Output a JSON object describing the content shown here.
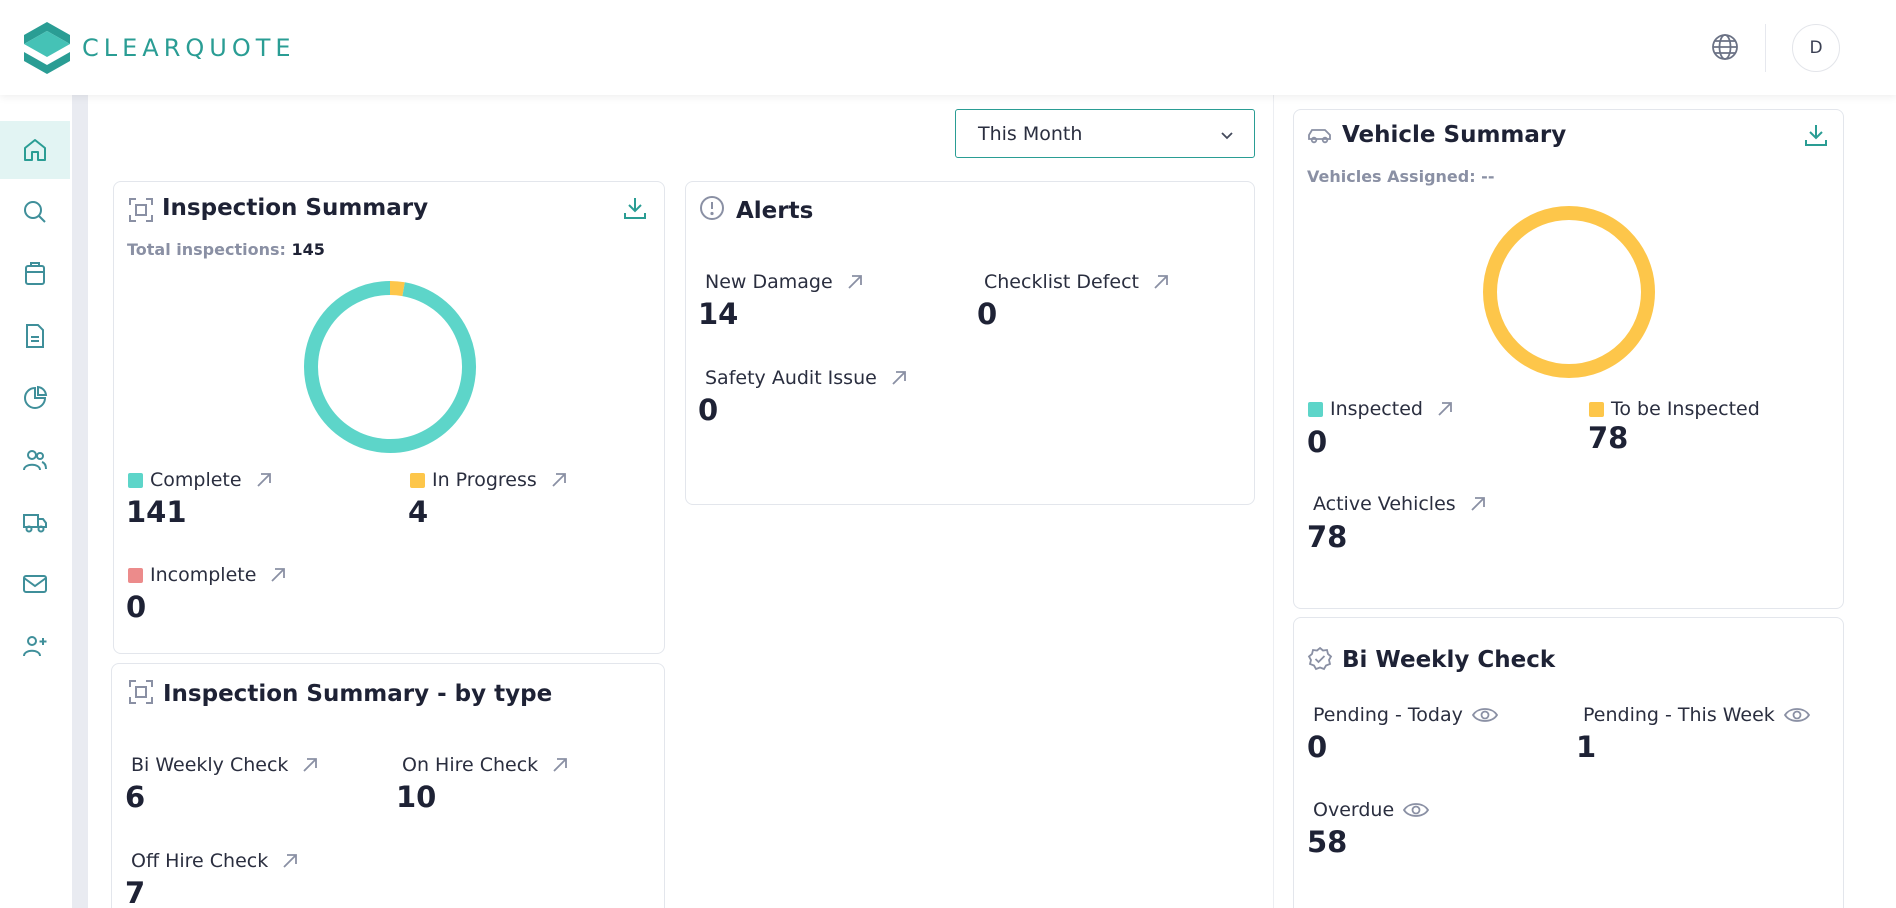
{
  "app": {
    "logo_text": "CLEARQUOTE",
    "user_initial": "D"
  },
  "colors": {
    "teal": "#5dd5c9",
    "yellow": "#fdc64a",
    "red": "#ec8b8b",
    "brand": "#2a9d94"
  },
  "filter": {
    "selected": "This Month"
  },
  "sidebar": {
    "items": [
      {
        "icon": "home-icon",
        "active": true
      },
      {
        "icon": "search-icon",
        "active": false
      },
      {
        "icon": "clipboard-icon",
        "active": false
      },
      {
        "icon": "document-icon",
        "active": false
      },
      {
        "icon": "pie-chart-icon",
        "active": false
      },
      {
        "icon": "users-icon",
        "active": false
      },
      {
        "icon": "truck-icon",
        "active": false
      },
      {
        "icon": "mail-icon",
        "active": false
      },
      {
        "icon": "user-plus-icon",
        "active": false
      }
    ]
  },
  "inspection_summary": {
    "title": "Inspection Summary",
    "total_label": "Total inspections:",
    "total_value": "145",
    "complete_label": "Complete",
    "complete_value": "141",
    "in_progress_label": "In Progress",
    "in_progress_value": "4",
    "incomplete_label": "Incomplete",
    "incomplete_value": "0",
    "chart": {
      "complete": 141,
      "in_progress": 4,
      "incomplete": 0
    }
  },
  "alerts": {
    "title": "Alerts",
    "new_damage_label": "New Damage",
    "new_damage_value": "14",
    "checklist_defect_label": "Checklist Defect",
    "checklist_defect_value": "0",
    "safety_audit_label": "Safety Audit Issue",
    "safety_audit_value": "0"
  },
  "inspection_by_type": {
    "title": "Inspection Summary - by type",
    "bi_weekly_label": "Bi Weekly Check",
    "bi_weekly_value": "6",
    "on_hire_label": "On Hire Check",
    "on_hire_value": "10",
    "off_hire_label": "Off Hire Check",
    "off_hire_value": "7"
  },
  "vehicle_summary": {
    "title": "Vehicle Summary",
    "assigned_label": "Vehicles Assigned: --",
    "inspected_label": "Inspected",
    "inspected_value": "0",
    "to_be_inspected_label": "To be Inspected",
    "to_be_inspected_value": "78",
    "active_label": "Active Vehicles",
    "active_value": "78",
    "chart": {
      "inspected": 0,
      "to_be_inspected": 78
    }
  },
  "bi_weekly_check": {
    "title": "Bi Weekly Check",
    "pending_today_label": "Pending - Today",
    "pending_today_value": "0",
    "pending_week_label": "Pending - This Week",
    "pending_week_value": "1",
    "overdue_label": "Overdue",
    "overdue_value": "58"
  }
}
